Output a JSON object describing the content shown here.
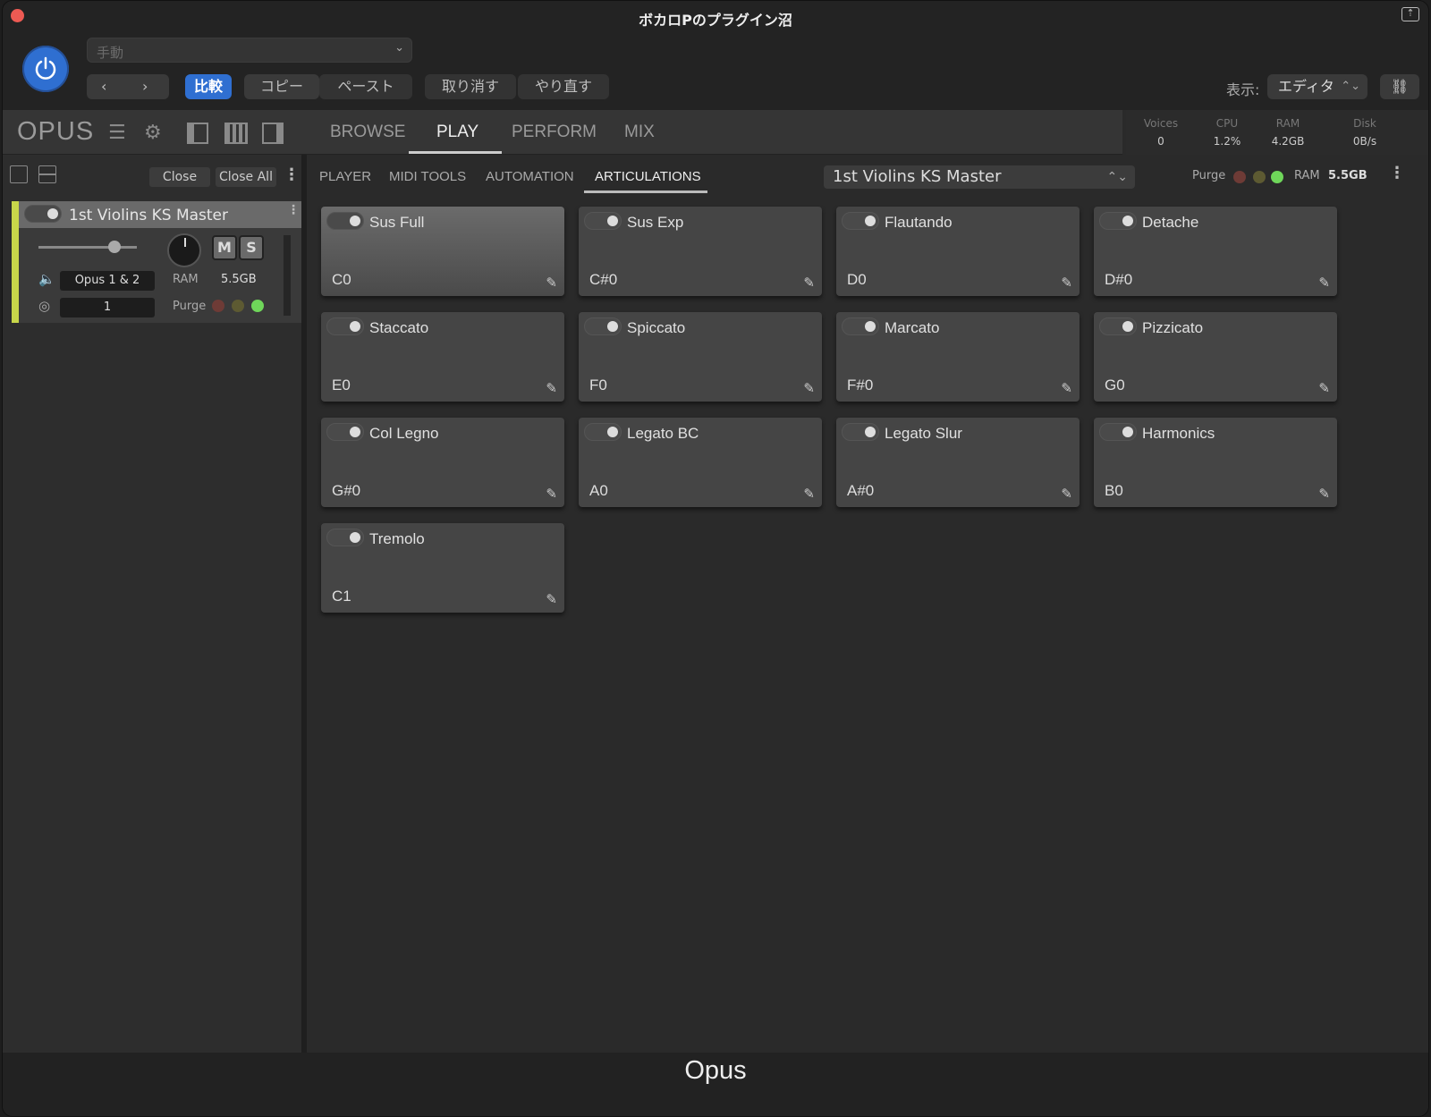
{
  "window": {
    "title": "ボカロPのプラグイン沼"
  },
  "host": {
    "preset_placeholder": "手動",
    "compare": "比較",
    "copy": "コピー",
    "paste": "ペースト",
    "undo": "取り消す",
    "redo": "やり直す",
    "view_label": "表示:",
    "view_value": "エディタ"
  },
  "opus": {
    "logo": "OPUS",
    "tabs": [
      "BROWSE",
      "PLAY",
      "PERFORM",
      "MIX"
    ],
    "active_tab": "PLAY",
    "stats": [
      {
        "label": "Voices",
        "value": "0"
      },
      {
        "label": "CPU",
        "value": "1.2%"
      },
      {
        "label": "RAM",
        "value": "4.2GB"
      },
      {
        "label": "Disk",
        "value": "0B/s"
      }
    ]
  },
  "left": {
    "close": "Close",
    "close_all": "Close All",
    "instrument": {
      "name": "1st Violins KS Master",
      "output": "Opus 1 & 2",
      "channel": "1",
      "ram_label": "RAM",
      "ram_value": "5.5GB",
      "purge_label": "Purge",
      "mute": "M",
      "solo": "S",
      "volume_level": 0.78
    }
  },
  "right": {
    "sub_tabs": [
      "PLAYER",
      "MIDI TOOLS",
      "AUTOMATION",
      "ARTICULATIONS"
    ],
    "active_sub_tab": "ARTICULATIONS",
    "instrument_select": "1st Violins KS Master",
    "purge_label": "Purge",
    "ram_label": "RAM",
    "ram_value": "5.5GB",
    "articulations": [
      {
        "name": "Sus Full",
        "key": "C0",
        "active": true
      },
      {
        "name": "Sus Exp",
        "key": "C#0",
        "active": false
      },
      {
        "name": "Flautando",
        "key": "D0",
        "active": false
      },
      {
        "name": "Detache",
        "key": "D#0",
        "active": false
      },
      {
        "name": "Staccato",
        "key": "E0",
        "active": false
      },
      {
        "name": "Spiccato",
        "key": "F0",
        "active": false
      },
      {
        "name": "Marcato",
        "key": "F#0",
        "active": false
      },
      {
        "name": "Pizzicato",
        "key": "G0",
        "active": false
      },
      {
        "name": "Col Legno",
        "key": "G#0",
        "active": false
      },
      {
        "name": "Legato BC",
        "key": "A0",
        "active": false
      },
      {
        "name": "Legato Slur",
        "key": "A#0",
        "active": false
      },
      {
        "name": "Harmonics",
        "key": "B0",
        "active": false
      },
      {
        "name": "Tremolo",
        "key": "C1",
        "active": false
      }
    ]
  },
  "footer": {
    "title": "Opus"
  },
  "colors": {
    "accent": "#2f6fd1",
    "track": "#c8d64a",
    "led_red": "#6e3b36",
    "led_yellow": "#5d5a32",
    "led_green": "#6fd65a"
  }
}
